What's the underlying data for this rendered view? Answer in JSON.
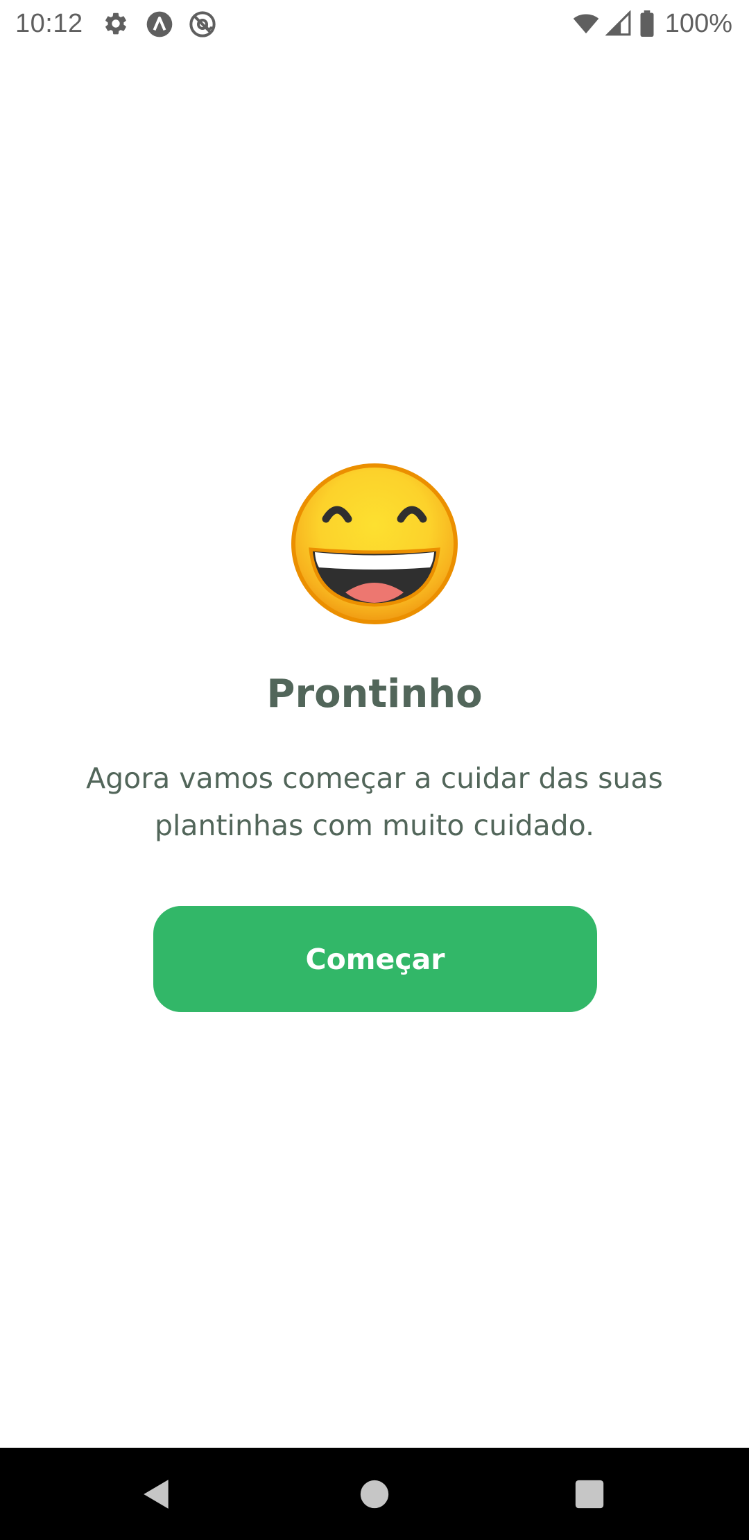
{
  "status_bar": {
    "time": "10:12",
    "battery": "100%",
    "icons_left": [
      "gear-icon",
      "a-circle-icon",
      "at-circle-icon"
    ],
    "icons_right": [
      "wifi-icon",
      "signal-icon",
      "battery-icon"
    ]
  },
  "main": {
    "emoji": "grinning-squinting-face",
    "title": "Prontinho",
    "subtitle_line1": "Agora vamos começar a cuidar das suas",
    "subtitle_line2": "plantinhas com muito cuidado.",
    "button_label": "Começar"
  },
  "colors": {
    "accent": "#32b768",
    "heading": "#52665a",
    "text": "#52665a",
    "nav_background": "#000000"
  },
  "nav_bar": {
    "buttons": [
      "back-icon",
      "home-icon",
      "recents-icon"
    ]
  }
}
